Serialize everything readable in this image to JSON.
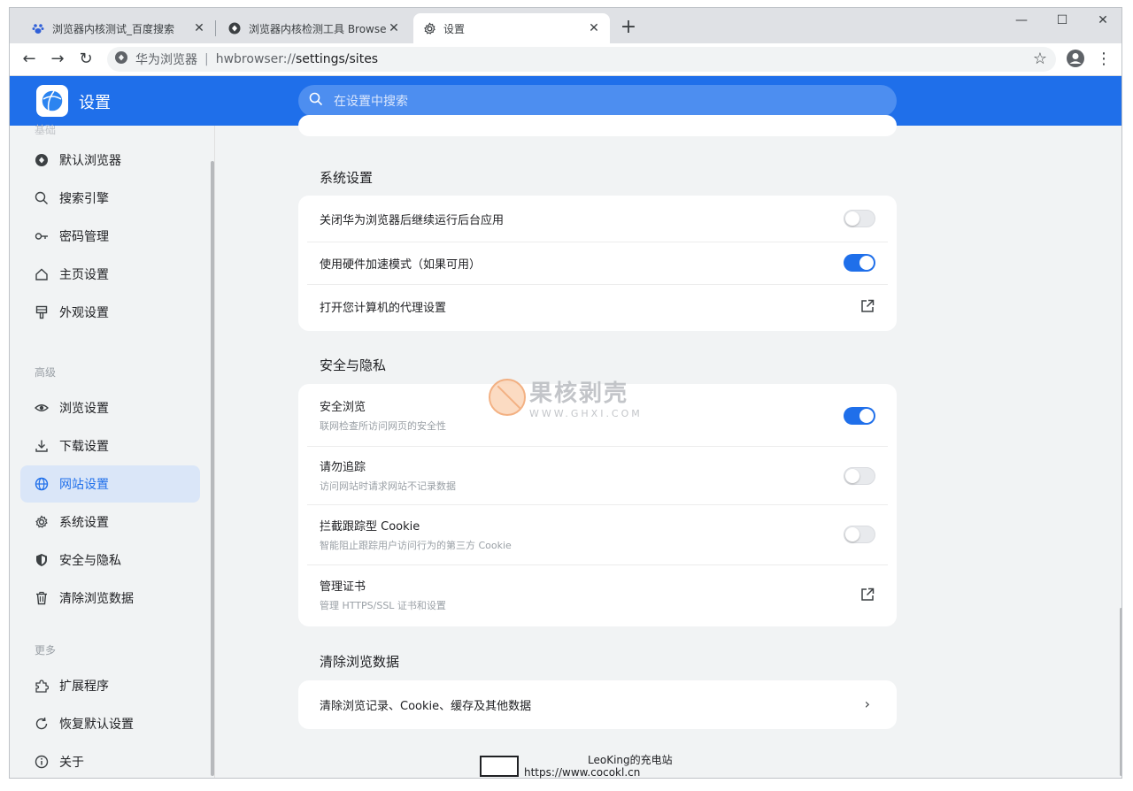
{
  "tabs": [
    {
      "title": "浏览器内核测试_百度搜索",
      "icon": "baidu-paw-icon",
      "active": false
    },
    {
      "title": "浏览器内核检测工具 Browser",
      "icon": "globe-badge-icon",
      "active": false
    },
    {
      "title": "设置",
      "icon": "gear-icon",
      "active": true
    }
  ],
  "toolbar": {
    "site_label": "华为浏览器",
    "url_scheme": "hwbrowser://",
    "url_path": "settings/sites"
  },
  "header": {
    "title": "设置",
    "search_placeholder": "在设置中搜索"
  },
  "sidebar": {
    "partial_group": "基础",
    "basic_items": [
      {
        "label": "默认浏览器",
        "icon": "browser-globe-icon"
      },
      {
        "label": "搜索引擎",
        "icon": "search-icon"
      },
      {
        "label": "密码管理",
        "icon": "key-icon"
      },
      {
        "label": "主页设置",
        "icon": "home-icon"
      },
      {
        "label": "外观设置",
        "icon": "paint-brush-icon"
      }
    ],
    "advanced_group": "高级",
    "advanced_items": [
      {
        "label": "浏览设置",
        "icon": "eye-icon"
      },
      {
        "label": "下载设置",
        "icon": "download-icon"
      },
      {
        "label": "网站设置",
        "icon": "globe-icon",
        "active": true
      },
      {
        "label": "系统设置",
        "icon": "gear-icon"
      },
      {
        "label": "安全与隐私",
        "icon": "shield-icon"
      },
      {
        "label": "清除浏览数据",
        "icon": "trash-icon"
      }
    ],
    "more_group": "更多",
    "more_items": [
      {
        "label": "扩展程序",
        "icon": "puzzle-icon"
      },
      {
        "label": "恢复默认设置",
        "icon": "reset-icon"
      },
      {
        "label": "关于",
        "icon": "info-icon"
      }
    ]
  },
  "sections": {
    "system": {
      "title": "系统设置",
      "rows": [
        {
          "label": "关闭华为浏览器后继续运行后台应用",
          "control": "toggle",
          "on": false
        },
        {
          "label": "使用硬件加速模式（如果可用）",
          "control": "toggle",
          "on": true
        },
        {
          "label": "打开您计算机的代理设置",
          "control": "external-link"
        }
      ]
    },
    "privacy": {
      "title": "安全与隐私",
      "rows": [
        {
          "label": "安全浏览",
          "sub": "联网检查所访问网页的安全性",
          "control": "toggle",
          "on": true
        },
        {
          "label": "请勿追踪",
          "sub": "访问网站时请求网站不记录数据",
          "control": "toggle",
          "on": false
        },
        {
          "label": "拦截跟踪型 Cookie",
          "sub": "智能阻止跟踪用户访问行为的第三方 Cookie",
          "control": "toggle",
          "on": false
        },
        {
          "label": "管理证书",
          "sub": "管理 HTTPS/SSL 证书和设置",
          "control": "external-link"
        }
      ]
    },
    "clear": {
      "title": "清除浏览数据",
      "rows": [
        {
          "label": "清除浏览记录、Cookie、缓存及其他数据",
          "control": "chevron"
        }
      ]
    }
  },
  "watermarks": {
    "brand_cn": "果核剥壳",
    "brand_url": "WWW.GHXI.COM",
    "author": "LeoKing的充电站",
    "author_url": "https://www.cocokl.cn"
  },
  "colors": {
    "accent": "#1f6fea",
    "active_nav_bg": "#dae6f8",
    "page_bg": "#f1f3f4"
  }
}
